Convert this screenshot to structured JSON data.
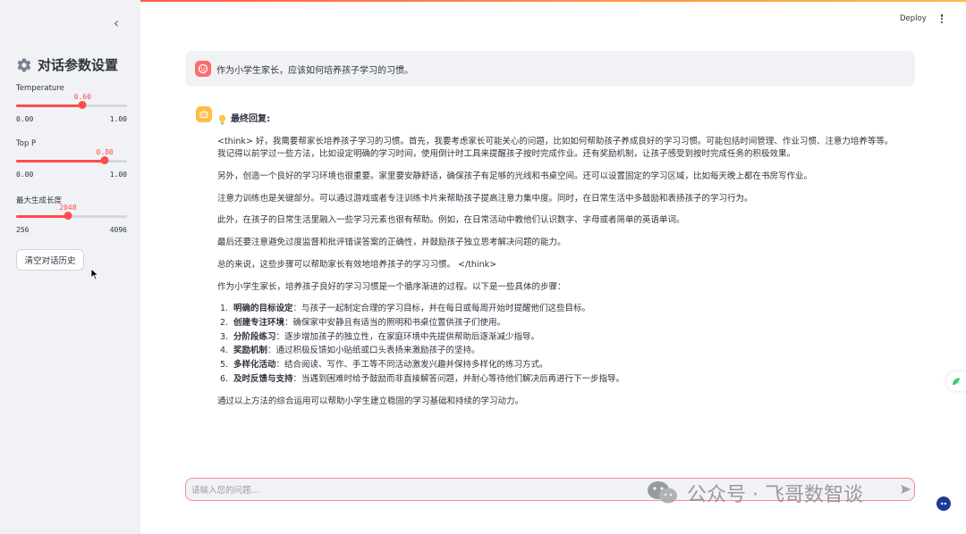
{
  "sidebar": {
    "collapse_icon": "chevron-left-icon",
    "title": "对话参数设置",
    "title_icon": "gear-icon",
    "params": [
      {
        "label": "Temperature",
        "value": "0.60",
        "min": "0.00",
        "max": "1.00",
        "fraction": 0.6
      },
      {
        "label": "Top P",
        "value": "0.80",
        "min": "0.00",
        "max": "1.00",
        "fraction": 0.8
      },
      {
        "label": "最大生成长度",
        "value": "2048",
        "min": "256",
        "max": "4096",
        "fraction": 0.4667
      }
    ],
    "clear_button": "清空对话历史"
  },
  "header": {
    "deploy_label": "Deploy",
    "menu_icon": "kebab-menu-icon"
  },
  "chat": {
    "user_message": "作为小学生家长，应该如何培养孩子学习的习惯。",
    "answer_title": "最终回复:",
    "answer_icon": "lightbulb-icon",
    "think_paragraphs": [
      "<think> 好，我需要帮家长培养孩子学习的习惯。首先，我要考虑家长可能关心的问题，比如如何帮助孩子养成良好的学习习惯。可能包括时间管理、作业习惯、注意力培养等等。",
      "我记得以前学过一些方法，比如设定明确的学习时间，使用倒计时工具来提醒孩子按时完成作业。还有奖励机制，让孩子感受到按时完成任务的积极效果。",
      "另外，创造一个良好的学习环境也很重要。家里要安静舒适，确保孩子有足够的光线和书桌空间。还可以设置固定的学习区域，比如每天晚上都在书房写作业。",
      "注意力训练也是关键部分。可以通过游戏或者专注训练卡片来帮助孩子提高注意力集中度。同时，在日常生活中多鼓励和表扬孩子的学习行为。",
      "此外，在孩子的日常生活里融入一些学习元素也很有帮助。例如，在日常活动中教他们认识数字、字母或者简单的英语单词。",
      "最后还要注意避免过度监督和批评错误答案的正确性，并鼓励孩子独立思考解决问题的能力。",
      "总的来说，这些步骤可以帮助家长有效地培养孩子的学习习惯。 </think>",
      "作为小学生家长，培养孩子良好的学习习惯是一个循序渐进的过程。以下是一些具体的步骤："
    ],
    "steps": [
      {
        "num": "1.",
        "title": "明确的目标设定",
        "text": "：与孩子一起制定合理的学习目标，并在每日或每周开始时提醒他们这些目标。"
      },
      {
        "num": "2.",
        "title": "创建专注环境",
        "text": "：确保家中安静且有适当的照明和书桌位置供孩子们使用。"
      },
      {
        "num": "3.",
        "title": "分阶段练习",
        "text": "：逐步增加孩子的独立性，在家庭环境中先提供帮助后逐渐减少指导。"
      },
      {
        "num": "4.",
        "title": "奖励机制",
        "text": "：通过积极反馈如小贴纸或口头表扬来激励孩子的坚持。"
      },
      {
        "num": "5.",
        "title": "多样化活动",
        "text": "：结合阅读、写作、手工等不同活动激发兴趣并保持多样化的练习方式。"
      },
      {
        "num": "6.",
        "title": "及时反馈与支持",
        "text": "：当遇到困难时给予鼓励而非直接解答问题，并耐心等待他们解决后再进行下一步指导。"
      }
    ],
    "conclusion": "通过以上方法的综合运用可以帮助小学生建立稳固的学习基础和持续的学习动力。"
  },
  "input": {
    "placeholder": "请输入您的问题...",
    "send_icon": "send-icon"
  },
  "watermark": {
    "text": "公众号 · 飞哥数智谈",
    "icon": "wechat-icon"
  },
  "colors": {
    "accent": "#ff4b4b",
    "sidebar_bg": "#f0f2f6",
    "bot_avatar": "#ffbd45",
    "user_avatar": "#ff6c6c"
  }
}
